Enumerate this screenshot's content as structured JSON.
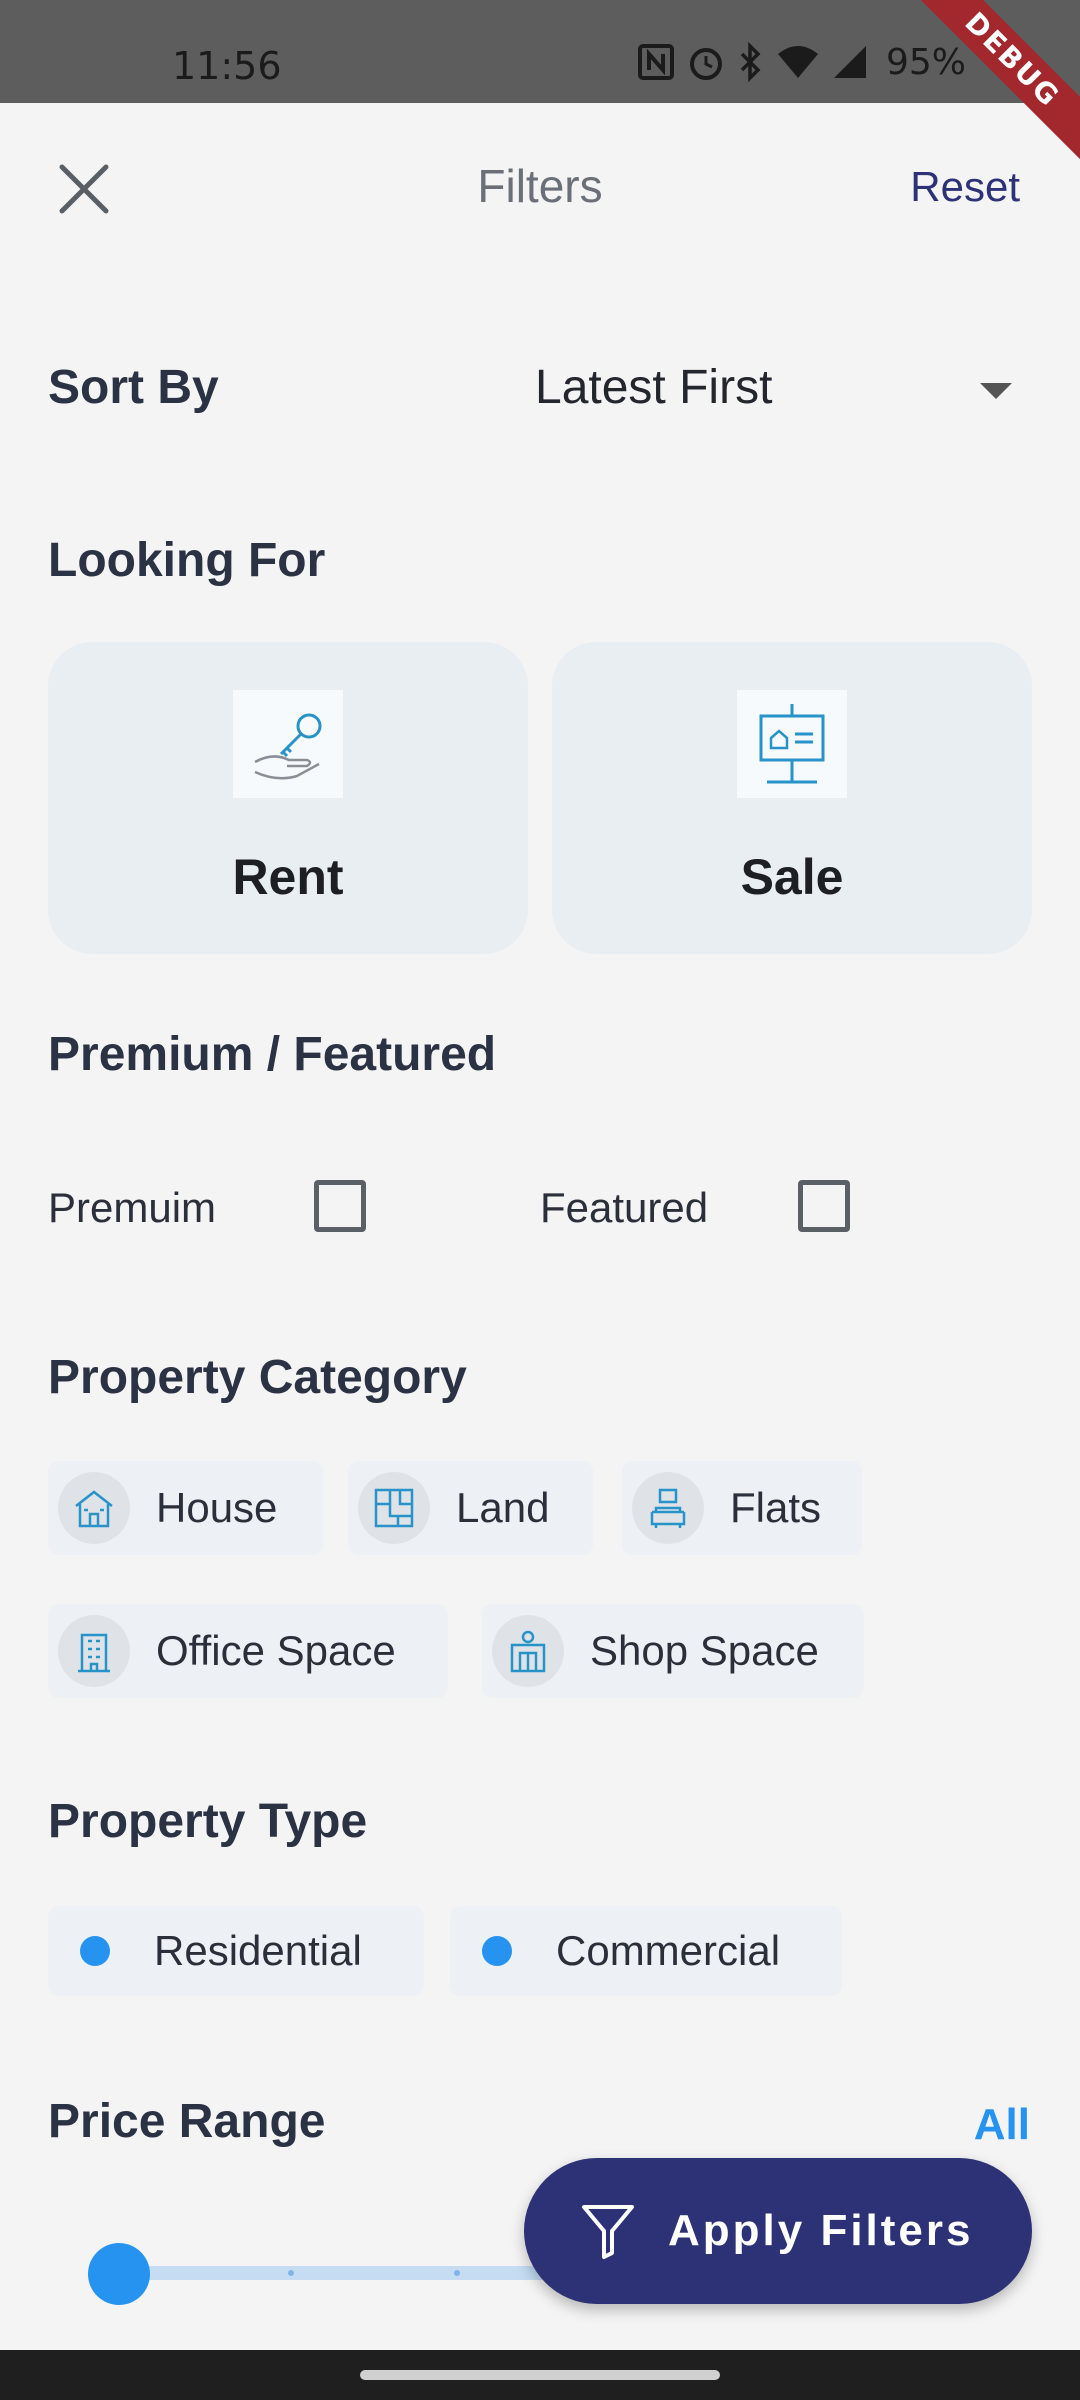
{
  "status_bar": {
    "time": "11:56",
    "battery": "95%",
    "debug_banner": "DEBUG"
  },
  "header": {
    "title": "Filters",
    "reset_label": "Reset",
    "close_icon": "close-icon"
  },
  "sort": {
    "label": "Sort By",
    "value": "Latest First"
  },
  "looking_for": {
    "label": "Looking For",
    "options": [
      {
        "label": "Rent",
        "icon": "key-in-hand-icon"
      },
      {
        "label": "Sale",
        "icon": "sale-signboard-icon"
      }
    ]
  },
  "premium": {
    "label": "Premium / Featured",
    "options": [
      {
        "label": "Premuim",
        "checked": false
      },
      {
        "label": "Featured",
        "checked": false
      }
    ]
  },
  "property_category": {
    "label": "Property Category",
    "items": [
      {
        "label": "House",
        "icon": "house-icon"
      },
      {
        "label": "Land",
        "icon": "land-plot-icon"
      },
      {
        "label": "Flats",
        "icon": "flats-sofa-icon"
      },
      {
        "label": "Office Space",
        "icon": "office-building-icon"
      },
      {
        "label": "Shop Space",
        "icon": "shop-storefront-icon"
      }
    ]
  },
  "property_type": {
    "label": "Property Type",
    "items": [
      {
        "label": "Residential"
      },
      {
        "label": "Commercial"
      }
    ]
  },
  "price_range": {
    "label": "Price Range",
    "all_label": "All"
  },
  "apply": {
    "label": "Apply Filters",
    "icon": "funnel-filter-icon"
  },
  "colors": {
    "primary": "#2c3275",
    "accent": "#2793f0",
    "background": "#f4f4f5"
  }
}
